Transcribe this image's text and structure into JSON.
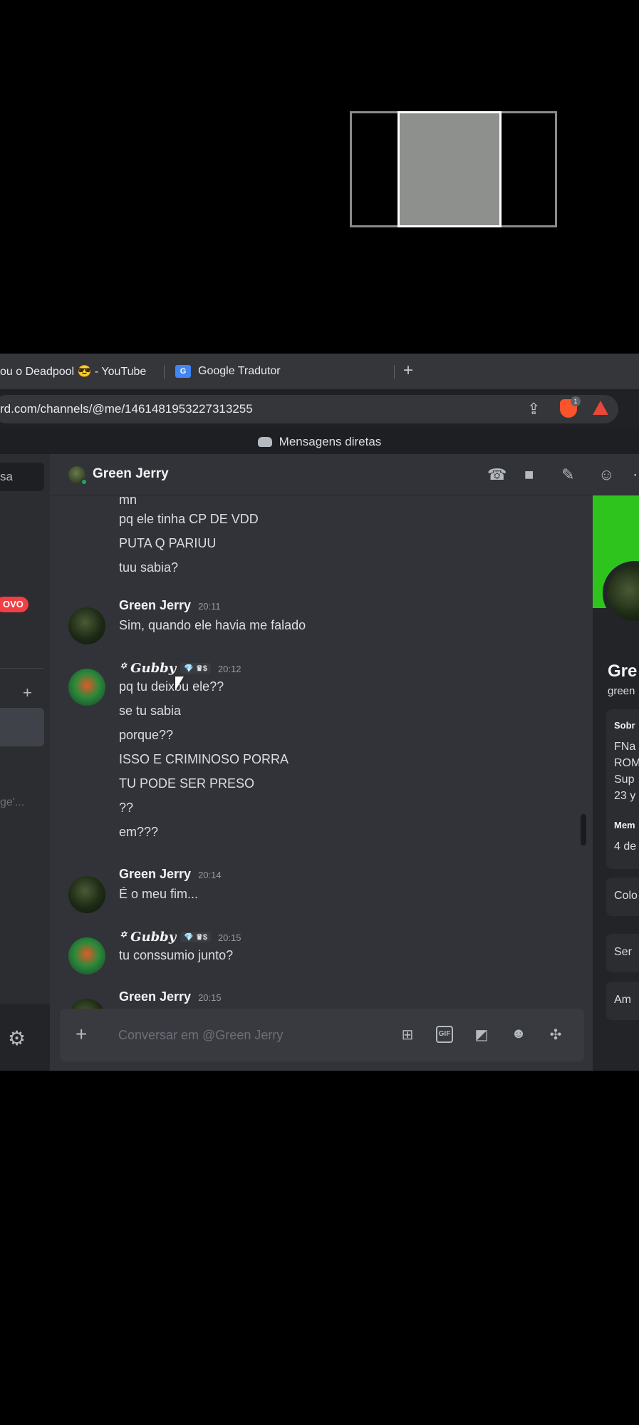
{
  "browser": {
    "tabs": [
      {
        "label": "ou o Deadpool 😎 - YouTube"
      },
      {
        "label": "Google Tradutor"
      }
    ],
    "url": "rd.com/channels/@me/1461481953227313255",
    "brave_badge": "1"
  },
  "window_title": "Mensagens diretas",
  "sidebar": {
    "search_fragment": "sa",
    "new_badge": "OVO",
    "truncated_item": "ge'..."
  },
  "channel": {
    "name": "Green Jerry"
  },
  "messages": {
    "fragment_mn": "mn",
    "m1": "pq ele tinha CP DE VDD",
    "m2": "PUTA Q PARIUU",
    "m3": "tuu sabia?",
    "g1": {
      "author": "Green Jerry",
      "time": "20:11",
      "text": "Sim, quando ele havia me falado"
    },
    "g2": {
      "author": "꙳ Gubby",
      "tag": "💎 ♛$",
      "time": "20:12",
      "lines": [
        "pq tu deixou ele??",
        "se tu sabia",
        "porque??",
        "ISSO E CRIMINOSO PORRA",
        "TU PODE SER PRESO",
        "??",
        "em???"
      ]
    },
    "g3": {
      "author": "Green Jerry",
      "time": "20:14",
      "text": "É o meu fim..."
    },
    "g4": {
      "author": "꙳ Gubby",
      "tag": "💎 ♛$",
      "time": "20:15",
      "text": "tu conssumio junto?"
    },
    "g5": {
      "author": "Green Jerry",
      "time": "20:15"
    }
  },
  "composer": {
    "placeholder": "Conversar em @Green Jerry",
    "gif_label": "GIF"
  },
  "profile": {
    "name": "Gre",
    "username": "green",
    "about_title": "Sobr",
    "bio": [
      "FNa",
      "ROM",
      "Sup",
      "23 y"
    ],
    "member_title": "Mem",
    "member_since": "4 de",
    "rows": [
      "Colo",
      "Ser",
      "Am"
    ]
  },
  "colors": {
    "banner": "#2fc41d",
    "new_badge": "#f23f43",
    "status_online": "#23a55a"
  }
}
